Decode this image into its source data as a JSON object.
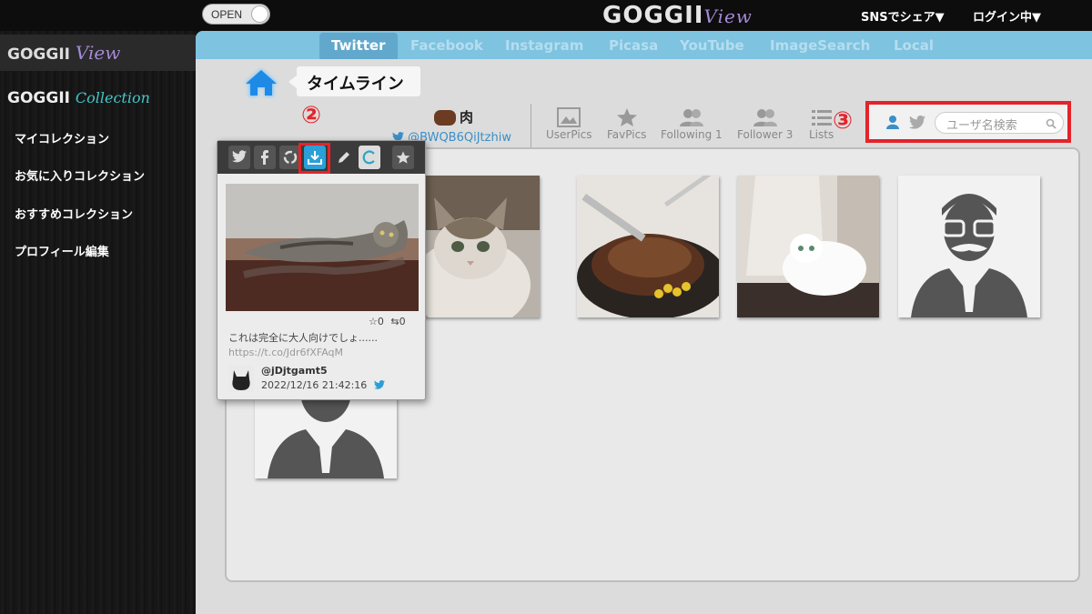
{
  "topbar": {
    "toggle_label": "OPEN",
    "brand_main": "GOGGII",
    "brand_sub": "View",
    "share_menu": "SNSでシェア▼",
    "login_menu": "ログイン中▼"
  },
  "sidebar": {
    "brand_main": "GOGGII",
    "brand_sub": "View",
    "collection_main": "GOGGII",
    "collection_sub": "Collection",
    "items": [
      {
        "label": "マイコレクション"
      },
      {
        "label": "お気に入りコレクション"
      },
      {
        "label": "おすすめコレクション"
      },
      {
        "label": "プロフィール編集"
      }
    ]
  },
  "tabs": [
    {
      "label": "Twitter",
      "active": true
    },
    {
      "label": "Facebook"
    },
    {
      "label": "Instagram"
    },
    {
      "label": "Picasa"
    },
    {
      "label": "YouTube"
    },
    {
      "label": "ImageSearch"
    },
    {
      "label": "Local"
    }
  ],
  "breadcrumb": {
    "label": "タイムライン"
  },
  "profile": {
    "name": "肉",
    "handle": "@BWQB6QiJtzhiw"
  },
  "nav_buttons": [
    {
      "label": "UserPics",
      "icon": "picture-icon"
    },
    {
      "label": "FavPics",
      "icon": "star-icon"
    },
    {
      "label": "Following 1",
      "icon": "users-icon"
    },
    {
      "label": "Follower 3",
      "icon": "users-icon"
    },
    {
      "label": "Lists",
      "icon": "list-icon"
    }
  ],
  "search": {
    "placeholder": "ユーザ名検索"
  },
  "annotations": {
    "step2": "②",
    "step3": "③"
  },
  "popup": {
    "likes": "☆0",
    "retweets": "⇆0",
    "text": "これは完全に大人向けでしょ......",
    "link": "https://t.co/Jdr6fXFAqM",
    "user": "@jDjtgamt5",
    "date": "2022/12/16 21:42:16"
  },
  "colors": {
    "accent_blue": "#61a8cc",
    "tabbar": "#7ec3e0",
    "highlight_red": "#e4232a",
    "sidebar_bg": "#151515",
    "main_bg": "#dcdcdc"
  }
}
